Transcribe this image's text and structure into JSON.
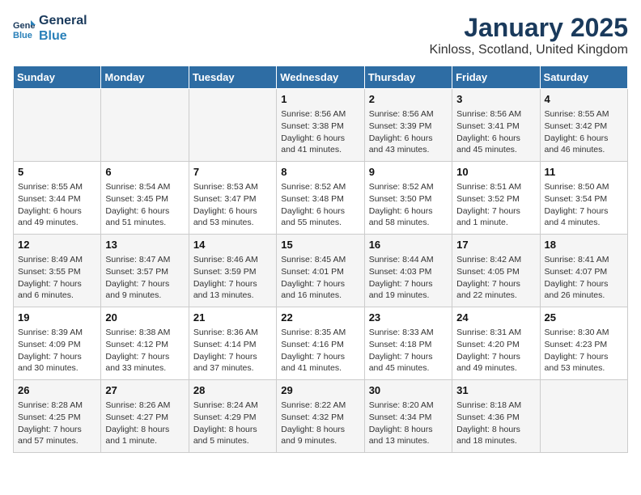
{
  "header": {
    "logo_line1": "General",
    "logo_line2": "Blue",
    "title": "January 2025",
    "subtitle": "Kinloss, Scotland, United Kingdom"
  },
  "days_of_week": [
    "Sunday",
    "Monday",
    "Tuesday",
    "Wednesday",
    "Thursday",
    "Friday",
    "Saturday"
  ],
  "weeks": [
    [
      {
        "day": "",
        "info": ""
      },
      {
        "day": "",
        "info": ""
      },
      {
        "day": "",
        "info": ""
      },
      {
        "day": "1",
        "info": "Sunrise: 8:56 AM\nSunset: 3:38 PM\nDaylight: 6 hours\nand 41 minutes."
      },
      {
        "day": "2",
        "info": "Sunrise: 8:56 AM\nSunset: 3:39 PM\nDaylight: 6 hours\nand 43 minutes."
      },
      {
        "day": "3",
        "info": "Sunrise: 8:56 AM\nSunset: 3:41 PM\nDaylight: 6 hours\nand 45 minutes."
      },
      {
        "day": "4",
        "info": "Sunrise: 8:55 AM\nSunset: 3:42 PM\nDaylight: 6 hours\nand 46 minutes."
      }
    ],
    [
      {
        "day": "5",
        "info": "Sunrise: 8:55 AM\nSunset: 3:44 PM\nDaylight: 6 hours\nand 49 minutes."
      },
      {
        "day": "6",
        "info": "Sunrise: 8:54 AM\nSunset: 3:45 PM\nDaylight: 6 hours\nand 51 minutes."
      },
      {
        "day": "7",
        "info": "Sunrise: 8:53 AM\nSunset: 3:47 PM\nDaylight: 6 hours\nand 53 minutes."
      },
      {
        "day": "8",
        "info": "Sunrise: 8:52 AM\nSunset: 3:48 PM\nDaylight: 6 hours\nand 55 minutes."
      },
      {
        "day": "9",
        "info": "Sunrise: 8:52 AM\nSunset: 3:50 PM\nDaylight: 6 hours\nand 58 minutes."
      },
      {
        "day": "10",
        "info": "Sunrise: 8:51 AM\nSunset: 3:52 PM\nDaylight: 7 hours\nand 1 minute."
      },
      {
        "day": "11",
        "info": "Sunrise: 8:50 AM\nSunset: 3:54 PM\nDaylight: 7 hours\nand 4 minutes."
      }
    ],
    [
      {
        "day": "12",
        "info": "Sunrise: 8:49 AM\nSunset: 3:55 PM\nDaylight: 7 hours\nand 6 minutes."
      },
      {
        "day": "13",
        "info": "Sunrise: 8:47 AM\nSunset: 3:57 PM\nDaylight: 7 hours\nand 9 minutes."
      },
      {
        "day": "14",
        "info": "Sunrise: 8:46 AM\nSunset: 3:59 PM\nDaylight: 7 hours\nand 13 minutes."
      },
      {
        "day": "15",
        "info": "Sunrise: 8:45 AM\nSunset: 4:01 PM\nDaylight: 7 hours\nand 16 minutes."
      },
      {
        "day": "16",
        "info": "Sunrise: 8:44 AM\nSunset: 4:03 PM\nDaylight: 7 hours\nand 19 minutes."
      },
      {
        "day": "17",
        "info": "Sunrise: 8:42 AM\nSunset: 4:05 PM\nDaylight: 7 hours\nand 22 minutes."
      },
      {
        "day": "18",
        "info": "Sunrise: 8:41 AM\nSunset: 4:07 PM\nDaylight: 7 hours\nand 26 minutes."
      }
    ],
    [
      {
        "day": "19",
        "info": "Sunrise: 8:39 AM\nSunset: 4:09 PM\nDaylight: 7 hours\nand 30 minutes."
      },
      {
        "day": "20",
        "info": "Sunrise: 8:38 AM\nSunset: 4:12 PM\nDaylight: 7 hours\nand 33 minutes."
      },
      {
        "day": "21",
        "info": "Sunrise: 8:36 AM\nSunset: 4:14 PM\nDaylight: 7 hours\nand 37 minutes."
      },
      {
        "day": "22",
        "info": "Sunrise: 8:35 AM\nSunset: 4:16 PM\nDaylight: 7 hours\nand 41 minutes."
      },
      {
        "day": "23",
        "info": "Sunrise: 8:33 AM\nSunset: 4:18 PM\nDaylight: 7 hours\nand 45 minutes."
      },
      {
        "day": "24",
        "info": "Sunrise: 8:31 AM\nSunset: 4:20 PM\nDaylight: 7 hours\nand 49 minutes."
      },
      {
        "day": "25",
        "info": "Sunrise: 8:30 AM\nSunset: 4:23 PM\nDaylight: 7 hours\nand 53 minutes."
      }
    ],
    [
      {
        "day": "26",
        "info": "Sunrise: 8:28 AM\nSunset: 4:25 PM\nDaylight: 7 hours\nand 57 minutes."
      },
      {
        "day": "27",
        "info": "Sunrise: 8:26 AM\nSunset: 4:27 PM\nDaylight: 8 hours\nand 1 minute."
      },
      {
        "day": "28",
        "info": "Sunrise: 8:24 AM\nSunset: 4:29 PM\nDaylight: 8 hours\nand 5 minutes."
      },
      {
        "day": "29",
        "info": "Sunrise: 8:22 AM\nSunset: 4:32 PM\nDaylight: 8 hours\nand 9 minutes."
      },
      {
        "day": "30",
        "info": "Sunrise: 8:20 AM\nSunset: 4:34 PM\nDaylight: 8 hours\nand 13 minutes."
      },
      {
        "day": "31",
        "info": "Sunrise: 8:18 AM\nSunset: 4:36 PM\nDaylight: 8 hours\nand 18 minutes."
      },
      {
        "day": "",
        "info": ""
      }
    ]
  ]
}
